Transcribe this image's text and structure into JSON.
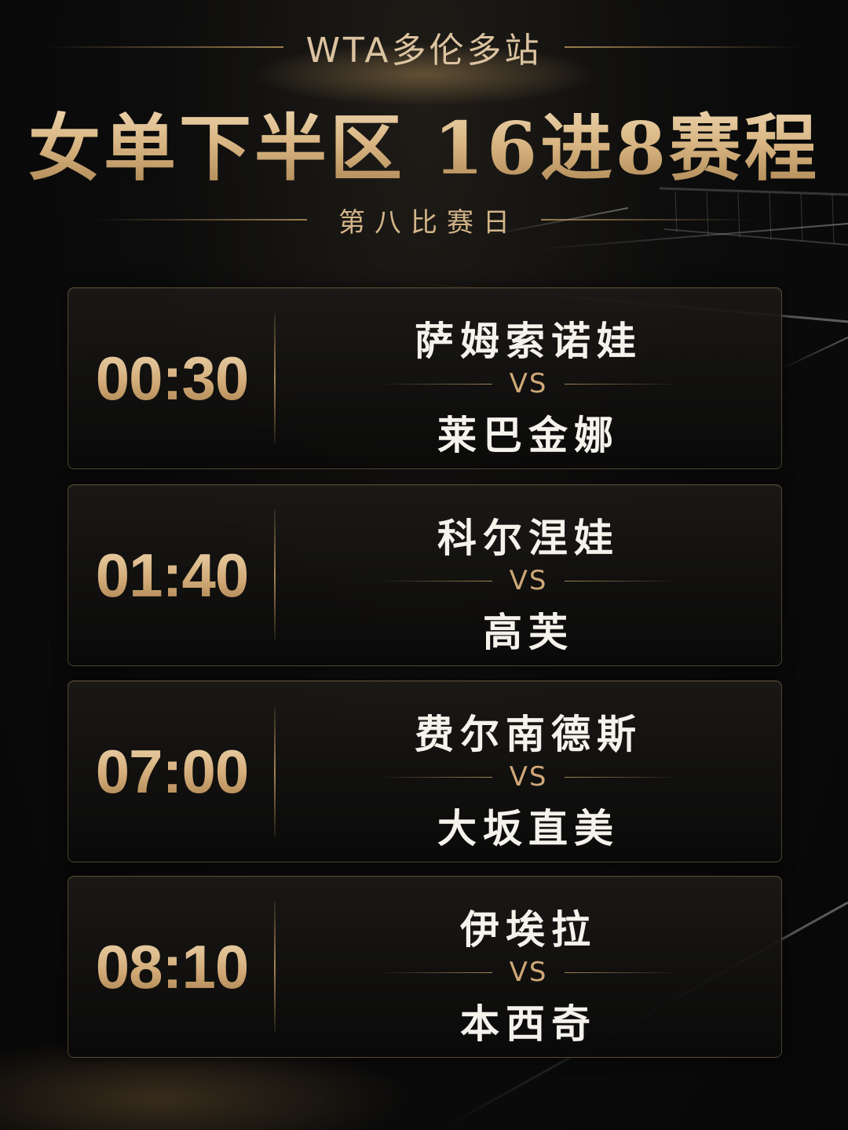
{
  "header": {
    "tour_title": "WTA多伦多站",
    "main_title": "女单下半区 16进8赛程",
    "day_label": "第八比赛日"
  },
  "matches": [
    {
      "time": "00:30",
      "player1": "萨姆索诺娃",
      "vs": "VS",
      "player2": "莱巴金娜"
    },
    {
      "time": "01:40",
      "player1": "科尔涅娃",
      "vs": "VS",
      "player2": "高芙"
    },
    {
      "time": "07:00",
      "player1": "费尔南德斯",
      "vs": "VS",
      "player2": "大坂直美"
    },
    {
      "time": "08:10",
      "player1": "伊埃拉",
      "vs": "VS",
      "player2": "本西奇"
    }
  ],
  "colors": {
    "gold": "#d6b285",
    "background": "#0c0c0c",
    "player_text": "#f5f2ec"
  }
}
